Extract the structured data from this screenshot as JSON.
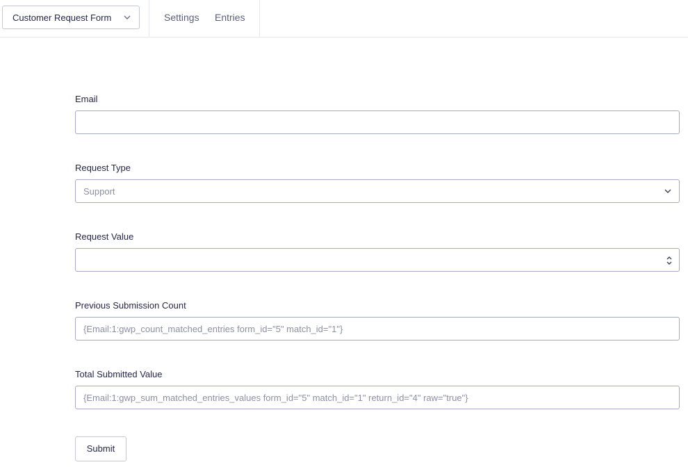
{
  "header": {
    "form_switcher": {
      "label": "Customer Request Form",
      "icon": "chevron-down-icon"
    },
    "nav": [
      {
        "label": "Settings"
      },
      {
        "label": "Entries"
      }
    ]
  },
  "form": {
    "fields": [
      {
        "label": "Email",
        "type": "text",
        "value": "",
        "placeholder": ""
      },
      {
        "label": "Request Type",
        "type": "select",
        "selected": "Support"
      },
      {
        "label": "Request Value",
        "type": "number",
        "value": ""
      },
      {
        "label": "Previous Submission Count",
        "type": "text",
        "placeholder": "{Email:1:gwp_count_matched_entries form_id=\"5\" match_id=\"1\"}"
      },
      {
        "label": "Total Submitted Value",
        "type": "text",
        "placeholder": "{Email:1:gwp_sum_matched_entries_values form_id=\"5\" match_id=\"1\" return_id=\"4\" raw=\"true\"}"
      }
    ],
    "submit_label": "Submit"
  },
  "colors": {
    "text": "#242748",
    "border": "#a6a9c2",
    "placeholder": "#8d8fa3"
  }
}
